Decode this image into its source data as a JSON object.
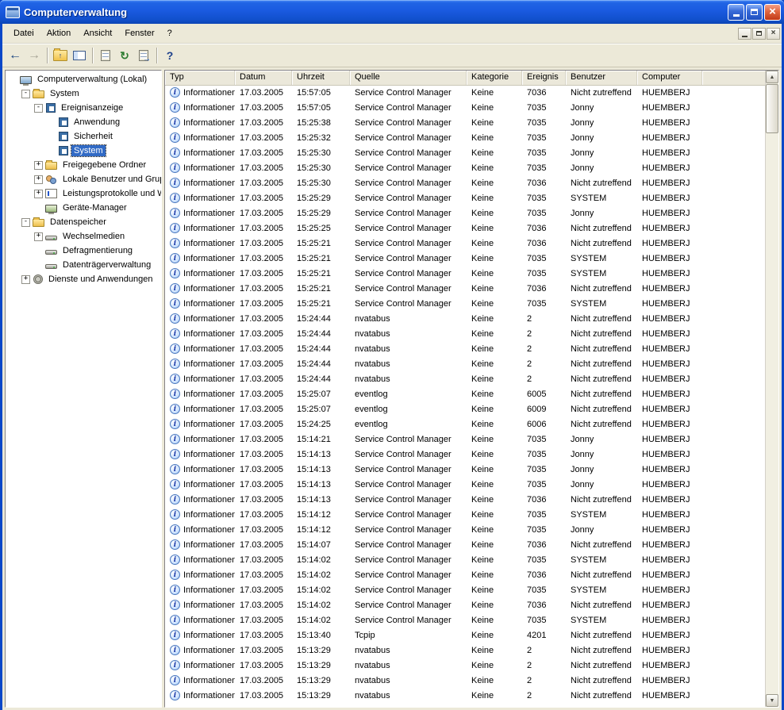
{
  "window": {
    "title": "Computerverwaltung",
    "accent_color": "#1150cc",
    "close_color": "#c13a17"
  },
  "menu": {
    "items": [
      "Datei",
      "Aktion",
      "Ansicht",
      "Fenster",
      "?"
    ]
  },
  "toolbar": {
    "buttons": [
      {
        "name": "back",
        "glyph": "←"
      },
      {
        "name": "forward",
        "glyph": "→",
        "disabled": true
      },
      {
        "separator": true
      },
      {
        "name": "up",
        "glyph": "↑"
      },
      {
        "name": "show-tree",
        "glyph": ""
      },
      {
        "separator": true
      },
      {
        "name": "properties",
        "glyph": ""
      },
      {
        "name": "refresh",
        "glyph": "↻"
      },
      {
        "name": "export-list",
        "glyph": ""
      },
      {
        "separator": true
      },
      {
        "name": "help",
        "glyph": "?"
      }
    ]
  },
  "tree": {
    "items": [
      {
        "label": "Computerverwaltung (Lokal)",
        "level": 0,
        "icon": "computer",
        "expander": "none",
        "selected": false
      },
      {
        "label": "System",
        "level": 1,
        "icon": "folder",
        "expander": "minus",
        "selected": false
      },
      {
        "label": "Ereignisanzeige",
        "level": 2,
        "icon": "book",
        "expander": "minus",
        "selected": false
      },
      {
        "label": "Anwendung",
        "level": 3,
        "icon": "book",
        "expander": "none",
        "selected": false
      },
      {
        "label": "Sicherheit",
        "level": 3,
        "icon": "book",
        "expander": "none",
        "selected": false
      },
      {
        "label": "System",
        "level": 3,
        "icon": "book",
        "expander": "none",
        "selected": true
      },
      {
        "label": "Freigegebene Ordner",
        "level": 2,
        "icon": "folder",
        "expander": "plus",
        "selected": false
      },
      {
        "label": "Lokale Benutzer und Gruppen",
        "level": 2,
        "icon": "users",
        "expander": "plus",
        "selected": false
      },
      {
        "label": "Leistungsprotokolle und Warnungen",
        "level": 2,
        "icon": "chart",
        "expander": "plus",
        "selected": false
      },
      {
        "label": "Geräte-Manager",
        "level": 2,
        "icon": "device",
        "expander": "none",
        "selected": false
      },
      {
        "label": "Datenspeicher",
        "level": 1,
        "icon": "folder",
        "expander": "minus",
        "selected": false
      },
      {
        "label": "Wechselmedien",
        "level": 2,
        "icon": "disk",
        "expander": "plus",
        "selected": false
      },
      {
        "label": "Defragmentierung",
        "level": 2,
        "icon": "disk",
        "expander": "none",
        "selected": false
      },
      {
        "label": "Datenträgerverwaltung",
        "level": 2,
        "icon": "disk",
        "expander": "none",
        "selected": false
      },
      {
        "label": "Dienste und Anwendungen",
        "level": 1,
        "icon": "gear",
        "expander": "plus",
        "selected": false
      }
    ]
  },
  "table": {
    "columns": [
      "Typ",
      "Datum",
      "Uhrzeit",
      "Quelle",
      "Kategorie",
      "Ereignis",
      "Benutzer",
      "Computer"
    ],
    "row_type_icon": "information-icon",
    "rows": [
      [
        "Informationen",
        "17.03.2005",
        "15:57:05",
        "Service Control Manager",
        "Keine",
        "7036",
        "Nicht zutreffend",
        "HUEMBERJ"
      ],
      [
        "Informationen",
        "17.03.2005",
        "15:57:05",
        "Service Control Manager",
        "Keine",
        "7035",
        "Jonny",
        "HUEMBERJ"
      ],
      [
        "Informationen",
        "17.03.2005",
        "15:25:38",
        "Service Control Manager",
        "Keine",
        "7035",
        "Jonny",
        "HUEMBERJ"
      ],
      [
        "Informationen",
        "17.03.2005",
        "15:25:32",
        "Service Control Manager",
        "Keine",
        "7035",
        "Jonny",
        "HUEMBERJ"
      ],
      [
        "Informationen",
        "17.03.2005",
        "15:25:30",
        "Service Control Manager",
        "Keine",
        "7035",
        "Jonny",
        "HUEMBERJ"
      ],
      [
        "Informationen",
        "17.03.2005",
        "15:25:30",
        "Service Control Manager",
        "Keine",
        "7035",
        "Jonny",
        "HUEMBERJ"
      ],
      [
        "Informationen",
        "17.03.2005",
        "15:25:30",
        "Service Control Manager",
        "Keine",
        "7036",
        "Nicht zutreffend",
        "HUEMBERJ"
      ],
      [
        "Informationen",
        "17.03.2005",
        "15:25:29",
        "Service Control Manager",
        "Keine",
        "7035",
        "SYSTEM",
        "HUEMBERJ"
      ],
      [
        "Informationen",
        "17.03.2005",
        "15:25:29",
        "Service Control Manager",
        "Keine",
        "7035",
        "Jonny",
        "HUEMBERJ"
      ],
      [
        "Informationen",
        "17.03.2005",
        "15:25:25",
        "Service Control Manager",
        "Keine",
        "7036",
        "Nicht zutreffend",
        "HUEMBERJ"
      ],
      [
        "Informationen",
        "17.03.2005",
        "15:25:21",
        "Service Control Manager",
        "Keine",
        "7036",
        "Nicht zutreffend",
        "HUEMBERJ"
      ],
      [
        "Informationen",
        "17.03.2005",
        "15:25:21",
        "Service Control Manager",
        "Keine",
        "7035",
        "SYSTEM",
        "HUEMBERJ"
      ],
      [
        "Informationen",
        "17.03.2005",
        "15:25:21",
        "Service Control Manager",
        "Keine",
        "7035",
        "SYSTEM",
        "HUEMBERJ"
      ],
      [
        "Informationen",
        "17.03.2005",
        "15:25:21",
        "Service Control Manager",
        "Keine",
        "7036",
        "Nicht zutreffend",
        "HUEMBERJ"
      ],
      [
        "Informationen",
        "17.03.2005",
        "15:25:21",
        "Service Control Manager",
        "Keine",
        "7035",
        "SYSTEM",
        "HUEMBERJ"
      ],
      [
        "Informationen",
        "17.03.2005",
        "15:24:44",
        "nvatabus",
        "Keine",
        "2",
        "Nicht zutreffend",
        "HUEMBERJ"
      ],
      [
        "Informationen",
        "17.03.2005",
        "15:24:44",
        "nvatabus",
        "Keine",
        "2",
        "Nicht zutreffend",
        "HUEMBERJ"
      ],
      [
        "Informationen",
        "17.03.2005",
        "15:24:44",
        "nvatabus",
        "Keine",
        "2",
        "Nicht zutreffend",
        "HUEMBERJ"
      ],
      [
        "Informationen",
        "17.03.2005",
        "15:24:44",
        "nvatabus",
        "Keine",
        "2",
        "Nicht zutreffend",
        "HUEMBERJ"
      ],
      [
        "Informationen",
        "17.03.2005",
        "15:24:44",
        "nvatabus",
        "Keine",
        "2",
        "Nicht zutreffend",
        "HUEMBERJ"
      ],
      [
        "Informationen",
        "17.03.2005",
        "15:25:07",
        "eventlog",
        "Keine",
        "6005",
        "Nicht zutreffend",
        "HUEMBERJ"
      ],
      [
        "Informationen",
        "17.03.2005",
        "15:25:07",
        "eventlog",
        "Keine",
        "6009",
        "Nicht zutreffend",
        "HUEMBERJ"
      ],
      [
        "Informationen",
        "17.03.2005",
        "15:24:25",
        "eventlog",
        "Keine",
        "6006",
        "Nicht zutreffend",
        "HUEMBERJ"
      ],
      [
        "Informationen",
        "17.03.2005",
        "15:14:21",
        "Service Control Manager",
        "Keine",
        "7035",
        "Jonny",
        "HUEMBERJ"
      ],
      [
        "Informationen",
        "17.03.2005",
        "15:14:13",
        "Service Control Manager",
        "Keine",
        "7035",
        "Jonny",
        "HUEMBERJ"
      ],
      [
        "Informationen",
        "17.03.2005",
        "15:14:13",
        "Service Control Manager",
        "Keine",
        "7035",
        "Jonny",
        "HUEMBERJ"
      ],
      [
        "Informationen",
        "17.03.2005",
        "15:14:13",
        "Service Control Manager",
        "Keine",
        "7035",
        "Jonny",
        "HUEMBERJ"
      ],
      [
        "Informationen",
        "17.03.2005",
        "15:14:13",
        "Service Control Manager",
        "Keine",
        "7036",
        "Nicht zutreffend",
        "HUEMBERJ"
      ],
      [
        "Informationen",
        "17.03.2005",
        "15:14:12",
        "Service Control Manager",
        "Keine",
        "7035",
        "SYSTEM",
        "HUEMBERJ"
      ],
      [
        "Informationen",
        "17.03.2005",
        "15:14:12",
        "Service Control Manager",
        "Keine",
        "7035",
        "Jonny",
        "HUEMBERJ"
      ],
      [
        "Informationen",
        "17.03.2005",
        "15:14:07",
        "Service Control Manager",
        "Keine",
        "7036",
        "Nicht zutreffend",
        "HUEMBERJ"
      ],
      [
        "Informationen",
        "17.03.2005",
        "15:14:02",
        "Service Control Manager",
        "Keine",
        "7035",
        "SYSTEM",
        "HUEMBERJ"
      ],
      [
        "Informationen",
        "17.03.2005",
        "15:14:02",
        "Service Control Manager",
        "Keine",
        "7036",
        "Nicht zutreffend",
        "HUEMBERJ"
      ],
      [
        "Informationen",
        "17.03.2005",
        "15:14:02",
        "Service Control Manager",
        "Keine",
        "7035",
        "SYSTEM",
        "HUEMBERJ"
      ],
      [
        "Informationen",
        "17.03.2005",
        "15:14:02",
        "Service Control Manager",
        "Keine",
        "7036",
        "Nicht zutreffend",
        "HUEMBERJ"
      ],
      [
        "Informationen",
        "17.03.2005",
        "15:14:02",
        "Service Control Manager",
        "Keine",
        "7035",
        "SYSTEM",
        "HUEMBERJ"
      ],
      [
        "Informationen",
        "17.03.2005",
        "15:13:40",
        "Tcpip",
        "Keine",
        "4201",
        "Nicht zutreffend",
        "HUEMBERJ"
      ],
      [
        "Informationen",
        "17.03.2005",
        "15:13:29",
        "nvatabus",
        "Keine",
        "2",
        "Nicht zutreffend",
        "HUEMBERJ"
      ],
      [
        "Informationen",
        "17.03.2005",
        "15:13:29",
        "nvatabus",
        "Keine",
        "2",
        "Nicht zutreffend",
        "HUEMBERJ"
      ],
      [
        "Informationen",
        "17.03.2005",
        "15:13:29",
        "nvatabus",
        "Keine",
        "2",
        "Nicht zutreffend",
        "HUEMBERJ"
      ],
      [
        "Informationen",
        "17.03.2005",
        "15:13:29",
        "nvatabus",
        "Keine",
        "2",
        "Nicht zutreffend",
        "HUEMBERJ"
      ]
    ]
  }
}
